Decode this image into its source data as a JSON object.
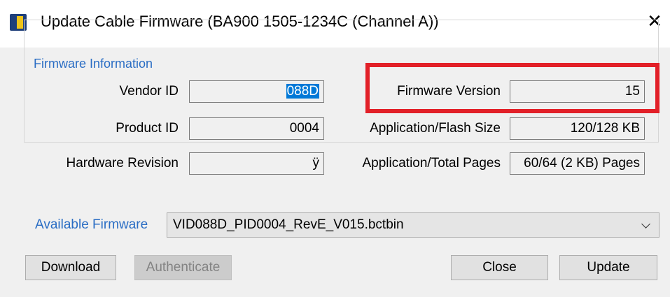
{
  "window": {
    "title": "Update Cable Firmware (BA900 1505-1234C (Channel A))",
    "close_symbol": "✕",
    "icon": "app-icon"
  },
  "firmware_info": {
    "group_title": "Firmware Information",
    "vendor_id": {
      "label": "Vendor ID",
      "value": "088D",
      "selected": true
    },
    "product_id": {
      "label": "Product ID",
      "value": "0004"
    },
    "hardware_revision": {
      "label": "Hardware Revision",
      "value": "ÿ"
    },
    "firmware_version": {
      "label": "Firmware Version",
      "value": "15"
    },
    "app_flash_size": {
      "label": "Application/Flash Size",
      "value": "120/128 KB"
    },
    "app_total_pages": {
      "label": "Application/Total Pages",
      "value": "60/64 (2 KB) Pages"
    }
  },
  "available_firmware": {
    "label": "Available Firmware",
    "value": "VID088D_PID0004_RevE_V015.bctbin"
  },
  "buttons": {
    "download": "Download",
    "authenticate": "Authenticate",
    "close": "Close",
    "update": "Update"
  },
  "colors": {
    "highlight": "#e22028",
    "accent": "#2a6dc4",
    "selection": "#0078d7"
  }
}
